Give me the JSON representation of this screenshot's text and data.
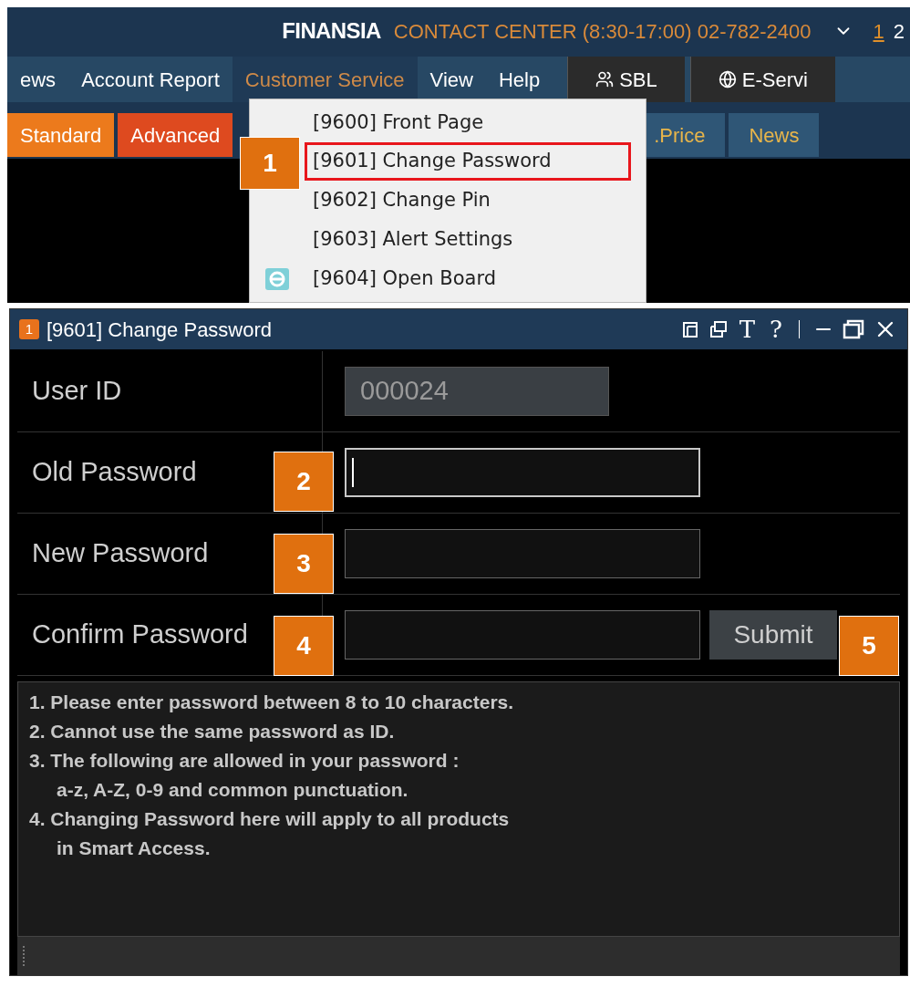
{
  "header": {
    "logo": "FINANSIA",
    "contact": "CONTACT CENTER (8:30-17:00) 02-782-2400",
    "screens": [
      {
        "label": "1",
        "selected": true
      },
      {
        "label": "2",
        "selected": false
      }
    ]
  },
  "menu_bar": {
    "items": [
      {
        "label": "ews",
        "selected": false
      },
      {
        "label": "Account Report",
        "selected": false
      },
      {
        "label": "Customer Service",
        "selected": true
      },
      {
        "label": "View",
        "selected": false
      },
      {
        "label": "Help",
        "selected": false
      }
    ],
    "buttons": [
      {
        "label": "SBL",
        "kind": "people"
      },
      {
        "label": "E-Servi",
        "kind": "globe"
      }
    ]
  },
  "tabs_left": [
    {
      "label": "Standard",
      "color": "#ec7a1c"
    },
    {
      "label": "Advanced",
      "color": "#de4a1f"
    }
  ],
  "tabs_right": [
    {
      "label": ".Price",
      "color": "#2f5676"
    },
    {
      "label": "News",
      "color": "#2f5676"
    }
  ],
  "dropdown": {
    "items": [
      {
        "label": "[9600] Front Page",
        "kind": "plain",
        "highlighted": false
      },
      {
        "label": "[9601] Change Password",
        "kind": "plain",
        "highlighted": true
      },
      {
        "label": "[9602] Change Pin",
        "kind": "plain",
        "highlighted": false
      },
      {
        "label": "[9603] Alert Settings",
        "kind": "plain",
        "highlighted": false
      },
      {
        "label": "[9604] Open Board",
        "kind": "browser",
        "highlighted": false
      }
    ]
  },
  "window": {
    "badge": "1",
    "title": "[9601] Change Password",
    "tools": [
      "T",
      "?"
    ],
    "rows": [
      {
        "label": "User ID",
        "kind": "readonly",
        "value": "000024"
      },
      {
        "label": "Old Password",
        "kind": "password",
        "focused": true
      },
      {
        "label": "New Password",
        "kind": "password",
        "focused": false
      },
      {
        "label": "Confirm Password",
        "kind": "password",
        "focused": false
      }
    ],
    "submit": "Submit",
    "notes": [
      {
        "text": "1. Please enter password between 8 to 10 characters.",
        "indent": false
      },
      {
        "text": "2. Cannot use the same password as ID.",
        "indent": false
      },
      {
        "text": "3. The following are allowed in your password :",
        "indent": false
      },
      {
        "text": "a-z, A-Z, 0-9 and common punctuation.",
        "indent": true
      },
      {
        "text": "4. Changing Password here will apply to all products",
        "indent": false
      },
      {
        "text": "in Smart Access.",
        "indent": true
      }
    ]
  },
  "callouts": [
    "1",
    "2",
    "3",
    "4",
    "5"
  ]
}
